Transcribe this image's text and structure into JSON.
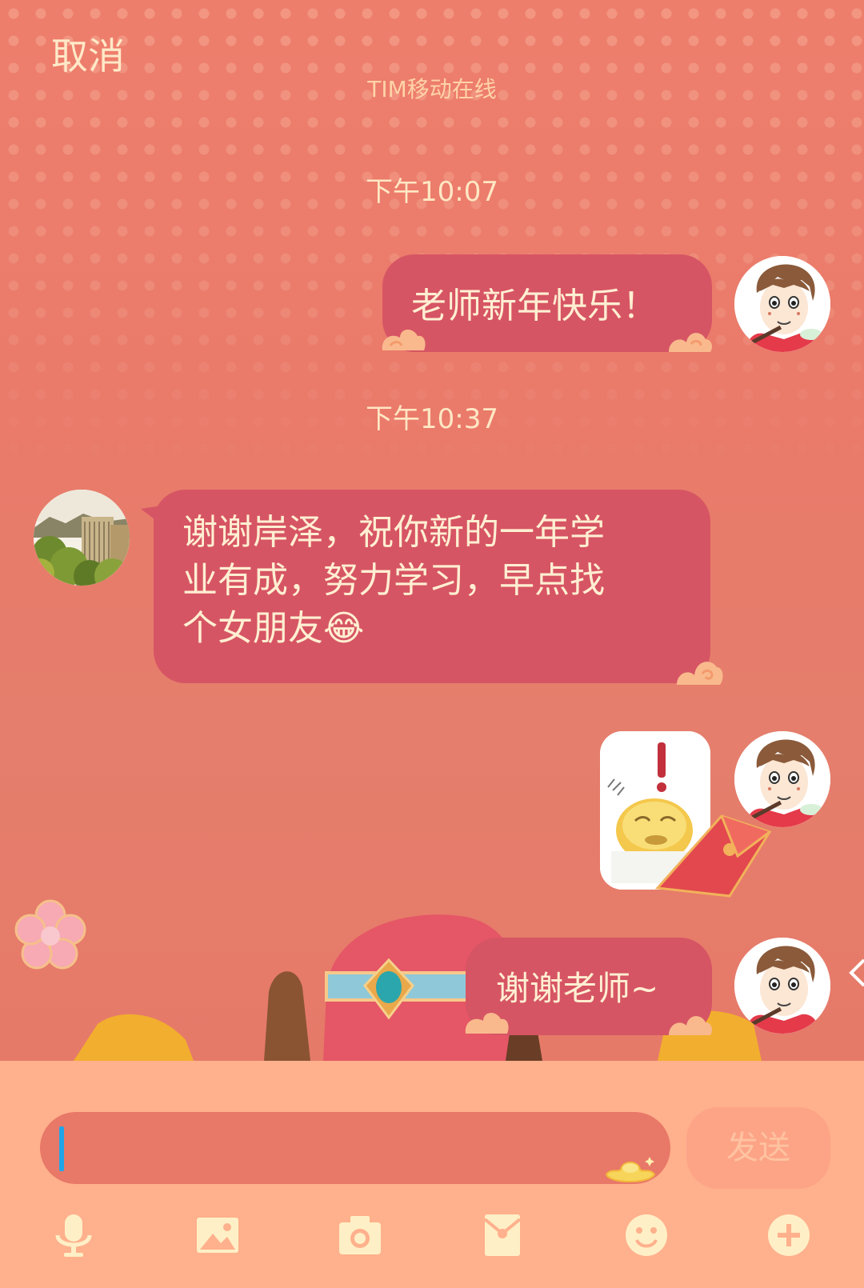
{
  "header": {
    "cancel_label": "取消",
    "status": "TIM移动在线"
  },
  "messages": [
    {
      "timestamp": "下午10:07"
    },
    {
      "side": "right",
      "text": "老师新年快乐！"
    },
    {
      "timestamp": "下午10:37"
    },
    {
      "side": "left",
      "lines": [
        "谢谢岸泽，祝你新的一年学",
        "业有成，努力学习，早点找",
        "个女朋友😂"
      ]
    },
    {
      "side": "right",
      "sticker": "surprised-emoji-sticker"
    },
    {
      "side": "right",
      "text": "谢谢老师~"
    }
  ],
  "input": {
    "placeholder": "",
    "value": ""
  },
  "send_label": "发送",
  "toolbar": [
    "microphone-icon",
    "image-icon",
    "camera-icon",
    "red-envelope-icon",
    "smiley-icon",
    "plus-icon"
  ],
  "colors": {
    "background": "#EA7A6A",
    "bubble": "#D65564",
    "bubble_text": "#FFEFD2",
    "input_panel": "#FFB08C",
    "caret": "#21A5E8"
  }
}
